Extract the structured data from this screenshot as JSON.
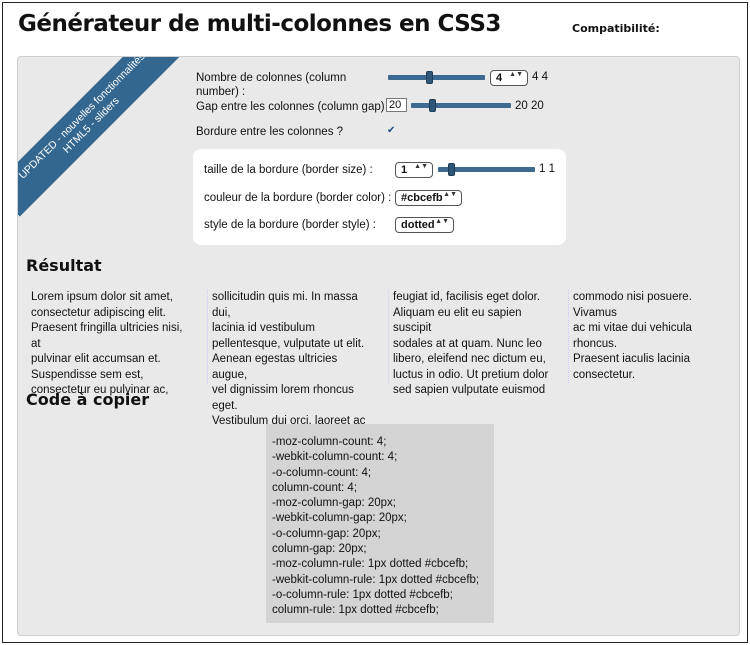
{
  "header": {
    "title": "Générateur de multi-colonnes en CSS3",
    "compat_label": "Compatibilité:"
  },
  "ribbon": {
    "line1": "UPDATED - nouvelles fonctionnalités",
    "line2": "HTML5 - sliders"
  },
  "controls": {
    "column_count": {
      "label_line1": "Nombre de colonnes (column",
      "label_line2": "number) :",
      "value": "4",
      "display": "4 4"
    },
    "column_gap": {
      "label": "Gap entre les colonnes (column gap) :",
      "value": "20",
      "display": "20 20"
    },
    "rule": {
      "label": "Bordure entre les colonnes ?",
      "checked": true,
      "check_glyph": "✔"
    },
    "border_size": {
      "label": "taille de la bordure (border size) :",
      "value": "1",
      "display": "1 1"
    },
    "border_color": {
      "label": "couleur de la bordure (border color) :",
      "value": "#cbcefb"
    },
    "border_style": {
      "label": "style de la bordure (border style) :",
      "value": "dotted"
    },
    "select_arrows": "▲▼"
  },
  "result": {
    "heading": "Résultat",
    "columns": [
      [
        "Lorem ipsum dolor sit amet,",
        "consectetur adipiscing elit.",
        "Praesent fringilla ultricies nisi, at",
        "pulvinar elit accumsan et.",
        "Suspendisse sem est,",
        "consectetur eu pulvinar ac,"
      ],
      [
        "sollicitudin quis mi. In massa dui,",
        "lacinia id vestibulum",
        "pellentesque, vulputate ut elit.",
        "Aenean egestas ultricies augue,",
        "vel dignissim lorem rhoncus eget.",
        "Vestibulum dui orci, laoreet ac"
      ],
      [
        "feugiat id, facilisis eget dolor.",
        "Aliquam eu elit eu sapien suscipit",
        "sodales at at quam. Nunc leo",
        "libero, eleifend nec dictum eu,",
        "luctus in odio. Ut pretium dolor",
        "sed sapien vulputate euismod"
      ],
      [
        "commodo nisi posuere. Vivamus",
        "ac mi vitae dui vehicula rhoncus.",
        "Praesent iaculis lacinia",
        "consectetur."
      ]
    ]
  },
  "code": {
    "heading": "Code à copier",
    "lines": [
      "-moz-column-count: 4;",
      "-webkit-column-count: 4;",
      "-o-column-count: 4;",
      "column-count: 4;",
      "-moz-column-gap: 20px;",
      "-webkit-column-gap: 20px;",
      "-o-column-gap: 20px;",
      "column-gap: 20px;",
      "-moz-column-rule: 1px dotted #cbcefb;",
      "-webkit-column-rule: 1px dotted #cbcefb;",
      "-o-column-rule: 1px dotted #cbcefb;",
      "column-rule: 1px dotted #cbcefb;"
    ]
  },
  "colors": {
    "accent": "#33678f",
    "rule": "#cbcefb",
    "panel": "#e9e9e9"
  }
}
